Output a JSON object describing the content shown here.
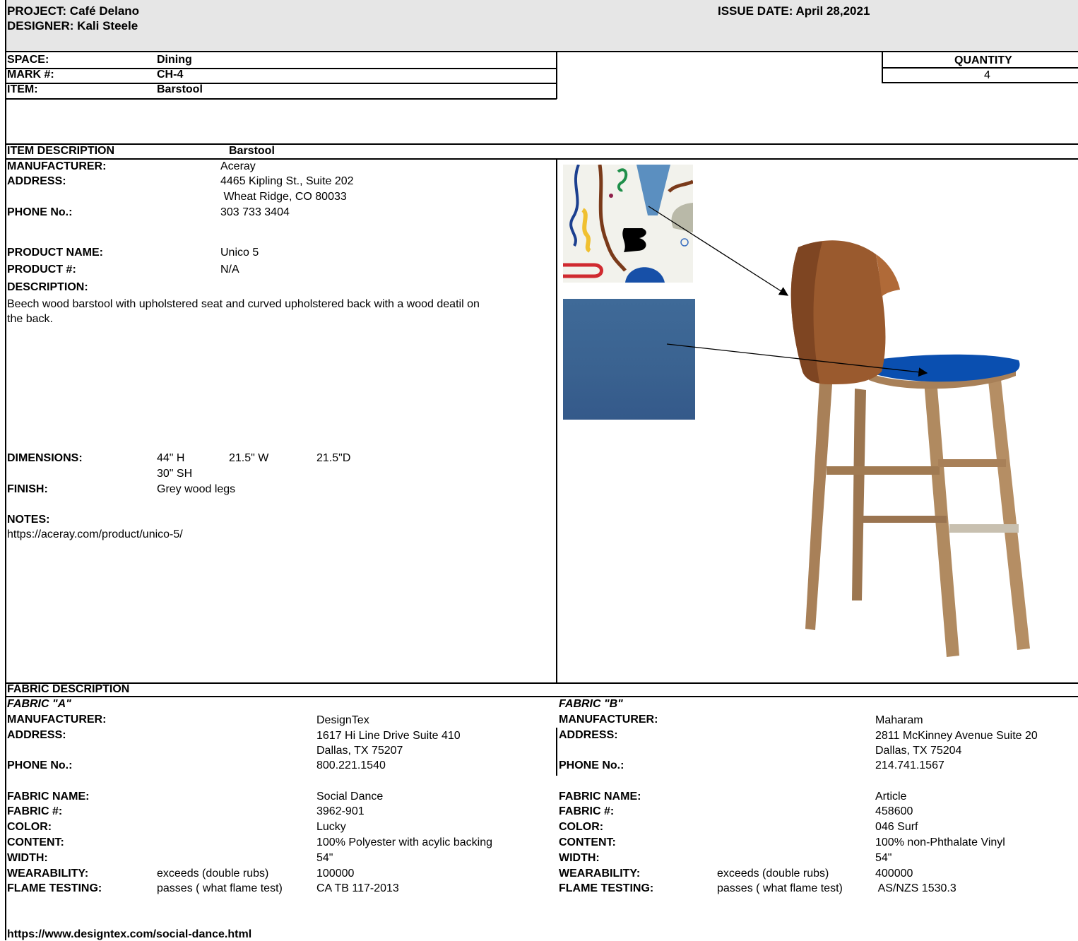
{
  "header": {
    "project": "PROJECT: Café Delano",
    "designer": "DESIGNER: Kali Steele",
    "issue_date": "ISSUE DATE: April 28,2021"
  },
  "item_info": {
    "space_label": "SPACE:",
    "space_value": "Dining",
    "mark_label": "MARK #:",
    "mark_value": "CH-4",
    "item_label": "ITEM:",
    "item_value": "Barstool"
  },
  "quantity": {
    "label": "QUANTITY",
    "value": "4"
  },
  "item_description": {
    "heading": "ITEM DESCRIPTION",
    "heading_value": "Barstool",
    "manufacturer_label": "MANUFACTURER:",
    "manufacturer": "Aceray",
    "address_label": "ADDRESS:",
    "address_line1": "4465 Kipling St., Suite 202",
    "address_line2": " Wheat Ridge, CO 80033",
    "phone_label": "PHONE No.:",
    "phone": "303 733 3404",
    "product_name_label": "PRODUCT NAME:",
    "product_name": "Unico 5",
    "product_num_label": "PRODUCT #:",
    "product_num": "N/A",
    "description_label": "DESCRIPTION:",
    "description_line1": "Beech wood barstool with upholstered seat and curved upholstered back with a wood deatil on",
    "description_line2": "the back.",
    "dimensions_label": "DIMENSIONS:",
    "dim_h": "44\" H",
    "dim_w": "21.5\" W",
    "dim_d": "21.5\"D",
    "dim_sh": "30\" SH",
    "finish_label": "FINISH:",
    "finish": "Grey wood legs",
    "notes_label": "NOTES:",
    "notes_url": "https://aceray.com/product/unico-5/"
  },
  "fabric": {
    "heading": "FABRIC DESCRIPTION",
    "a": {
      "title": "FABRIC \"A\"",
      "manufacturer_label": "MANUFACTURER:",
      "manufacturer": "DesignTex",
      "address_label": "ADDRESS:",
      "address_line1": "1617 Hi Line Drive Suite 410",
      "address_line2": "Dallas, TX 75207",
      "phone_label": "PHONE No.:",
      "phone": "800.221.1540",
      "name_label": "FABRIC NAME:",
      "name": "Social Dance",
      "num_label": "FABRIC #:",
      "num": "3962-901",
      "color_label": "COLOR:",
      "color": "Lucky",
      "content_label": "CONTENT:",
      "content": "100% Polyester with acylic backing",
      "width_label": "WIDTH:",
      "width": "54\"",
      "wear_label": "WEARABILITY:",
      "wear_note": "exceeds (double rubs)",
      "wear_value": "100000",
      "flame_label": "FLAME TESTING:",
      "flame_note": "passes ( what flame test)",
      "flame_value": "CA TB 117-2013",
      "url": "https://www.designtex.com/social-dance.html"
    },
    "b": {
      "title": "FABRIC \"B\"",
      "manufacturer_label": "MANUFACTURER:",
      "manufacturer": "Maharam",
      "address_label": "ADDRESS:",
      "address_line1": "2811 McKinney Avenue Suite 20",
      "address_line2": "Dallas, TX 75204",
      "phone_label": "PHONE No.:",
      "phone": "214.741.1567",
      "name_label": "FABRIC NAME:",
      "name": "Article",
      "num_label": "FABRIC #:",
      "num": "458600",
      "color_label": "COLOR:",
      "color": "046 Surf",
      "content_label": "CONTENT:",
      "content": "100% non-Phthalate Vinyl",
      "width_label": "WIDTH:",
      "width": "54\"",
      "wear_label": "WEARABILITY:",
      "wear_note": "exceeds (double rubs)",
      "wear_value": "400000",
      "flame_label": "FLAME TESTING:",
      "flame_note": "passes ( what flame test)",
      "flame_value": " AS/NZS 1530.3"
    }
  },
  "colors": {
    "header_band": "#e6e6e6",
    "chair_upholstery": "#9a5a2e",
    "seat_cushion": "#0a4fb0",
    "wood_legs": "#b08a60",
    "fabric_b_swatch": "#3a6290"
  }
}
